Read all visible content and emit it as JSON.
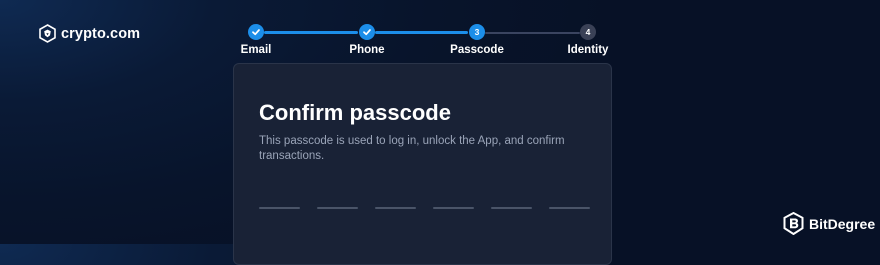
{
  "brand": {
    "name": "crypto.com",
    "icon": "crypto-lion-shield-icon"
  },
  "steps": [
    {
      "label": "Email",
      "status": "completed",
      "icon": "check-icon"
    },
    {
      "label": "Phone",
      "status": "completed",
      "icon": "check-icon"
    },
    {
      "label": "Passcode",
      "status": "current",
      "number": "3"
    },
    {
      "label": "Identity",
      "status": "upcoming",
      "number": "4"
    }
  ],
  "card": {
    "title": "Confirm passcode",
    "description": "This passcode is used to log in, unlock the App, and confirm transactions.",
    "pin_length": 6
  },
  "watermark": {
    "text": "BitDegree",
    "icon": "bitdegree-logo-icon"
  },
  "colors": {
    "accent": "#1c8ee9",
    "card_bg": "#192236",
    "background": "#08142b",
    "muted_text": "#9aa4b8"
  }
}
